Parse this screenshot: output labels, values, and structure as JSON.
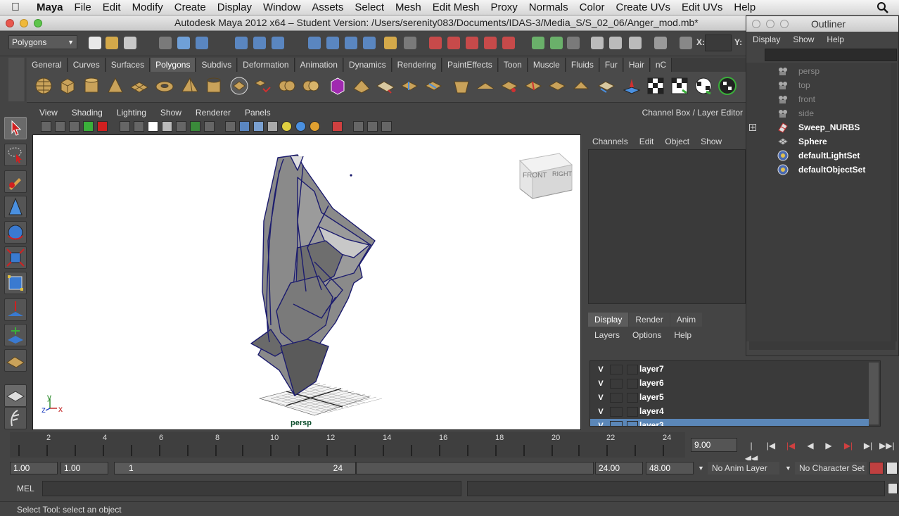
{
  "menubar": {
    "app": "Maya",
    "items": [
      "File",
      "Edit",
      "Modify",
      "Create",
      "Display",
      "Window",
      "Assets",
      "Select",
      "Mesh",
      "Edit Mesh",
      "Proxy",
      "Normals",
      "Color",
      "Create UVs",
      "Edit UVs",
      "Help"
    ]
  },
  "window": {
    "title": "Autodesk Maya 2012 x64 – Student Version: /Users/serenity083/Documents/IDAS-3/Media_S/S_02_06/Anger_mod.mb*"
  },
  "statusline": {
    "mode": "Polygons",
    "x_label": "X:",
    "y_label": "Y:"
  },
  "shelf": {
    "tabs": [
      "General",
      "Curves",
      "Surfaces",
      "Polygons",
      "Subdivs",
      "Deformation",
      "Animation",
      "Dynamics",
      "Rendering",
      "PaintEffects",
      "Toon",
      "Muscle",
      "Fluids",
      "Fur",
      "Hair",
      "nC"
    ],
    "active_tab": "Polygons"
  },
  "panel": {
    "menus": [
      "View",
      "Shading",
      "Lighting",
      "Show",
      "Renderer",
      "Panels"
    ],
    "camera": "persp",
    "viewcube_front": "FRONT",
    "viewcube_right": "RIGHT",
    "axis_y": "y",
    "axis_z": "z",
    "axis_x": "x"
  },
  "channelbox": {
    "header": "Channel Box / Layer Editor",
    "menus": [
      "Channels",
      "Edit",
      "Object",
      "Show"
    ]
  },
  "layereditor": {
    "tabs": [
      "Display",
      "Render",
      "Anim"
    ],
    "active_tab": "Display",
    "menus": [
      "Layers",
      "Options",
      "Help"
    ],
    "layers": [
      {
        "vis": "V",
        "name": "layer7"
      },
      {
        "vis": "V",
        "name": "layer6"
      },
      {
        "vis": "V",
        "name": "layer5"
      },
      {
        "vis": "V",
        "name": "layer4"
      },
      {
        "vis": "V",
        "name": "layer3"
      }
    ]
  },
  "outliner": {
    "title": "Outliner",
    "menus": [
      "Display",
      "Show",
      "Help"
    ],
    "items": [
      {
        "name": "persp",
        "style": "dim"
      },
      {
        "name": "top",
        "style": "dim"
      },
      {
        "name": "front",
        "style": "dim"
      },
      {
        "name": "side",
        "style": "dim"
      },
      {
        "name": "Sweep_NURBS",
        "style": "bright"
      },
      {
        "name": "Sphere",
        "style": "bright"
      },
      {
        "name": "defaultLightSet",
        "style": "bright"
      },
      {
        "name": "defaultObjectSet",
        "style": "bright"
      }
    ]
  },
  "timeline": {
    "ticks": [
      "2",
      "4",
      "6",
      "8",
      "10",
      "12",
      "14",
      "16",
      "18",
      "20",
      "22",
      "24"
    ],
    "current_time": "9.00"
  },
  "range": {
    "start_min": "1.00",
    "start": "1.00",
    "slider_start": "1",
    "slider_end": "24",
    "end": "24.00",
    "end_max": "48.00",
    "anim_layer": "No Anim Layer",
    "character_set": "No Character Set"
  },
  "cmdline": {
    "label": "MEL"
  },
  "helpline": {
    "text": "Select Tool: select an object"
  },
  "colors": {
    "wire": "#1c1c6e",
    "shape_fill": "#8a8a8a",
    "layer_selected": "#5b87b8"
  }
}
